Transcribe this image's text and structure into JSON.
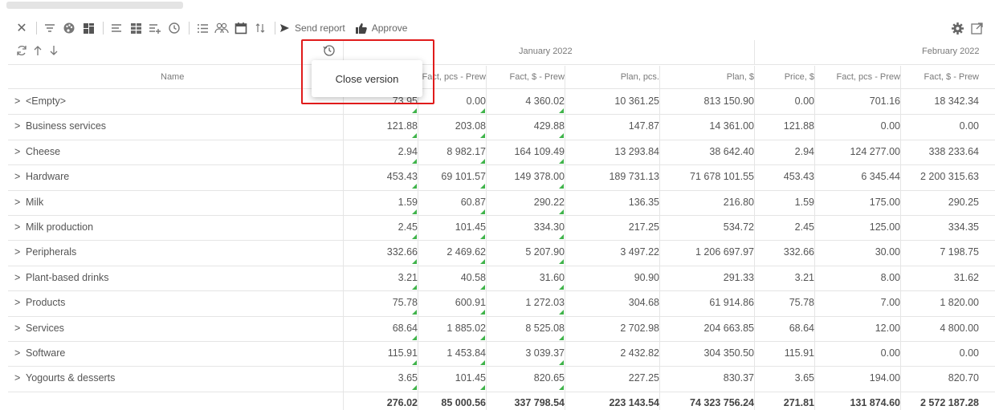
{
  "toolbar": {
    "send_report": "Send report",
    "approve": "Approve"
  },
  "tooltip": {
    "text": "Close version"
  },
  "header": {
    "name": "Name",
    "january": "January 2022",
    "february": "February 2022",
    "columns": [
      "Fact, pcs - Prew",
      "Fact, $ - Prew",
      "Plan, pcs.",
      "Plan, $",
      "Price, $",
      "Fact, pcs - Prew",
      "Fact, $ - Prew"
    ]
  },
  "rows": [
    {
      "name": "<Empty>",
      "v": [
        "73.95",
        "0.00",
        "4 360.02",
        "10 361.25",
        "813 150.90",
        "0.00",
        "701.16",
        "18 342.34"
      ]
    },
    {
      "name": "Business services",
      "v": [
        "121.88",
        "203.08",
        "429.88",
        "147.87",
        "14 361.00",
        "121.88",
        "0.00",
        "0.00"
      ]
    },
    {
      "name": "Cheese",
      "v": [
        "2.94",
        "8 982.17",
        "164 109.49",
        "13 293.84",
        "38 642.40",
        "2.94",
        "124 277.00",
        "338 233.64"
      ]
    },
    {
      "name": "Hardware",
      "v": [
        "453.43",
        "69 101.57",
        "149 378.00",
        "189 731.13",
        "71 678 101.55",
        "453.43",
        "6 345.44",
        "2 200 315.63"
      ]
    },
    {
      "name": "Milk",
      "v": [
        "1.59",
        "60.87",
        "290.22",
        "136.35",
        "216.80",
        "1.59",
        "175.00",
        "290.25"
      ]
    },
    {
      "name": "Milk production",
      "v": [
        "2.45",
        "101.45",
        "334.30",
        "217.25",
        "534.72",
        "2.45",
        "125.00",
        "334.35"
      ]
    },
    {
      "name": "Peripherals",
      "v": [
        "332.66",
        "2 469.62",
        "5 207.90",
        "3 497.22",
        "1 206 697.97",
        "332.66",
        "30.00",
        "7 198.75"
      ]
    },
    {
      "name": "Plant-based drinks",
      "v": [
        "3.21",
        "40.58",
        "31.60",
        "90.90",
        "291.33",
        "3.21",
        "8.00",
        "31.62"
      ]
    },
    {
      "name": "Products",
      "v": [
        "75.78",
        "600.91",
        "1 272.03",
        "304.68",
        "61 914.86",
        "75.78",
        "7.00",
        "1 820.00"
      ]
    },
    {
      "name": "Services",
      "v": [
        "68.64",
        "1 885.02",
        "8 525.08",
        "2 702.98",
        "204 663.85",
        "68.64",
        "12.00",
        "4 800.00"
      ]
    },
    {
      "name": "Software",
      "v": [
        "115.91",
        "1 453.84",
        "3 039.37",
        "2 432.82",
        "304 350.50",
        "115.91",
        "0.00",
        "0.00"
      ]
    },
    {
      "name": "Yogourts & desserts",
      "v": [
        "3.65",
        "101.45",
        "820.65",
        "227.25",
        "830.37",
        "3.65",
        "194.00",
        "820.70"
      ]
    }
  ],
  "totals": [
    "276.02",
    "85 000.56",
    "337 798.54",
    "223 143.54",
    "74 323 756.24",
    "271.81",
    "131 874.60",
    "2 572 187.28"
  ],
  "icons": {
    "close": "close-icon",
    "filter": "filter-icon",
    "palette": "palette-icon",
    "grid": "grid-icon",
    "rows": "rows-icon",
    "table": "table-icon",
    "add-rows": "add-rows-icon",
    "history": "history-icon",
    "list": "list-icon",
    "users": "users-icon",
    "calendar": "calendar-icon",
    "sort": "sort-icon",
    "send": "send-icon",
    "thumb": "thumbs-up-icon",
    "gear": "gear-icon",
    "expand": "external-icon",
    "refresh": "refresh-icon",
    "up": "arrow-up-icon",
    "down": "arrow-down-icon"
  },
  "colors": {
    "highlight": "#e01b1b",
    "marker": "#3fb34a"
  }
}
